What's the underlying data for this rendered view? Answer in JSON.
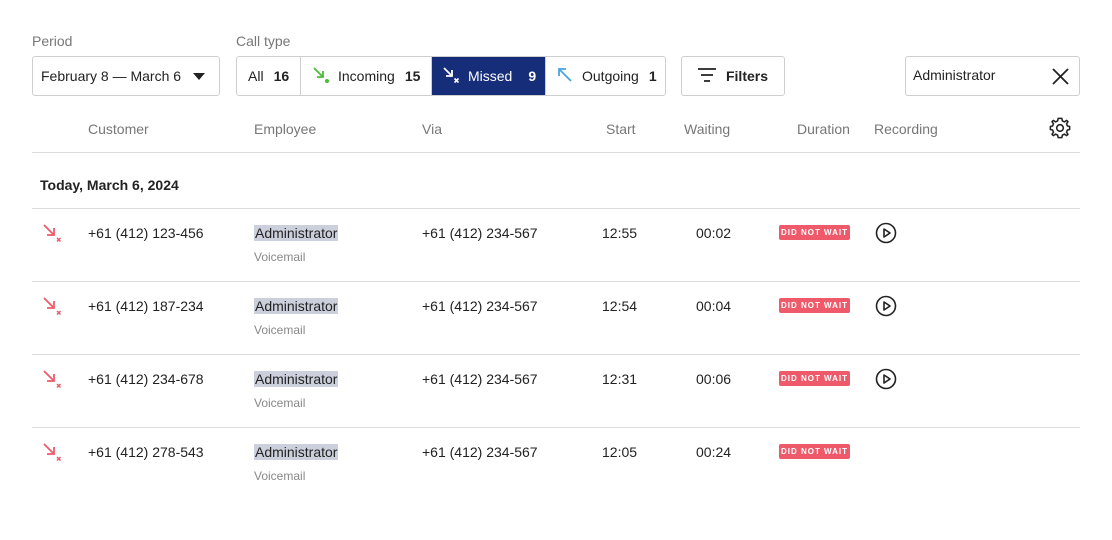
{
  "period": {
    "label": "Period",
    "value": "February 8 — March 6"
  },
  "call_type": {
    "label": "Call type",
    "options": [
      {
        "label": "All",
        "count": "16"
      },
      {
        "label": "Incoming",
        "count": "15"
      },
      {
        "label": "Missed",
        "count": "9"
      },
      {
        "label": "Outgoing",
        "count": "1"
      }
    ]
  },
  "filters": {
    "label": "Filters"
  },
  "search": {
    "value": "Administrator"
  },
  "table": {
    "headers": {
      "customer": "Customer",
      "employee": "Employee",
      "via": "Via",
      "start": "Start",
      "waiting": "Waiting",
      "duration": "Duration",
      "recording": "Recording"
    },
    "group_label": "Today, March 6, 2024",
    "rows": [
      {
        "customer": "+61 (412) 123-456",
        "employee": "Administrator",
        "employee_sub": "Voicemail",
        "via": "+61 (412) 234-567",
        "start": "12:55",
        "waiting": "00:02",
        "badge": "DID NOT WAIT"
      },
      {
        "customer": "+61 (412) 187-234",
        "employee": "Administrator",
        "employee_sub": "Voicemail",
        "via": "+61 (412) 234-567",
        "start": "12:54",
        "waiting": "00:04",
        "badge": "DID NOT WAIT"
      },
      {
        "customer": "+61 (412) 234-678",
        "employee": "Administrator",
        "employee_sub": "Voicemail",
        "via": "+61 (412) 234-567",
        "start": "12:31",
        "waiting": "00:06",
        "badge": "DID NOT WAIT"
      },
      {
        "customer": "+61 (412) 278-543",
        "employee": "Administrator",
        "employee_sub": "Voicemail",
        "via": "+61 (412) 234-567",
        "start": "12:05",
        "waiting": "00:24",
        "badge": "DID NOT WAIT"
      }
    ]
  },
  "colors": {
    "accent": "#162d7a",
    "missed": "#ee5a6a",
    "incoming": "#4cbb3a",
    "outgoing": "#4aa3e0"
  },
  "icons": {
    "period_caret": "caret-down-icon",
    "filters": "filter-lines-icon",
    "clear": "close-icon",
    "settings": "gear-icon",
    "recording": "play-icon",
    "row_type": "missed-call-icon"
  }
}
